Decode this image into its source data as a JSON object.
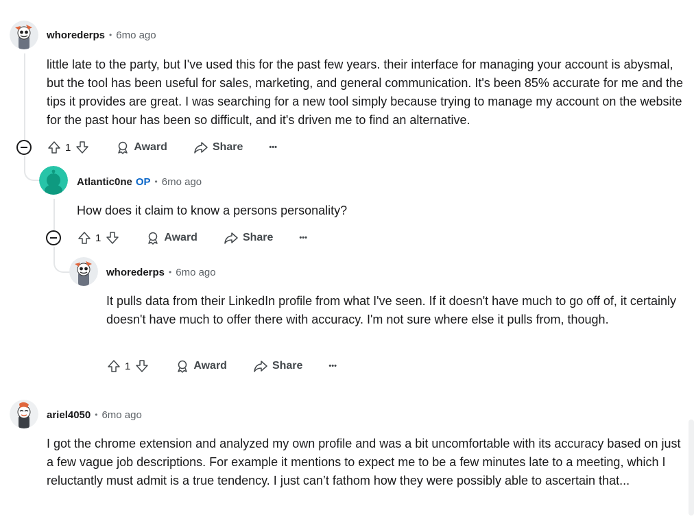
{
  "comments": [
    {
      "author": "whorederps",
      "op_badge": "",
      "dot": "•",
      "time": "6mo ago",
      "body": "little late to the party, but I've used this for the past few years. their interface for managing your account is abysmal, but the tool has been useful for sales, marketing, and general communication. It's been 85% accurate for me and the tips it provides are great. I was searching for a new tool simply because trying to manage my account on the website for the past hour has been so difficult, and it's driven me to find an alternative.",
      "votes": "1",
      "award_label": "Award",
      "share_label": "Share",
      "more_label": "•••"
    },
    {
      "author": "Atlantic0ne",
      "op_badge": "OP",
      "dot": "•",
      "time": "6mo ago",
      "body": "How does it claim to know a persons personality?",
      "votes": "1",
      "award_label": "Award",
      "share_label": "Share",
      "more_label": "•••"
    },
    {
      "author": "whorederps",
      "op_badge": "",
      "dot": "•",
      "time": "6mo ago",
      "body": "It pulls data from their LinkedIn profile from what I've seen. If it doesn't have much to go off of, it certainly doesn't have much to offer there with accuracy. I'm not sure where else it pulls from, though.",
      "votes": "1",
      "award_label": "Award",
      "share_label": "Share",
      "more_label": "•••"
    },
    {
      "author": "ariel4050",
      "op_badge": "",
      "dot": "•",
      "time": "6mo ago",
      "body": "I got the chrome extension and analyzed my own profile and was a bit uncomfortable with its accuracy based on just a few vague job descriptions. For example it mentions to expect me to be a few minutes late to a meeting, which I reluctantly must admit is a true tendency. I just can’t fathom how they were possibly able to ascertain that..."
    }
  ],
  "colors": {
    "text": "#1a1a1b",
    "meta": "#5c6166",
    "op": "#0a66c8",
    "thread_line": "#e4e6e8",
    "teal_avatar": "#27c4a8"
  }
}
